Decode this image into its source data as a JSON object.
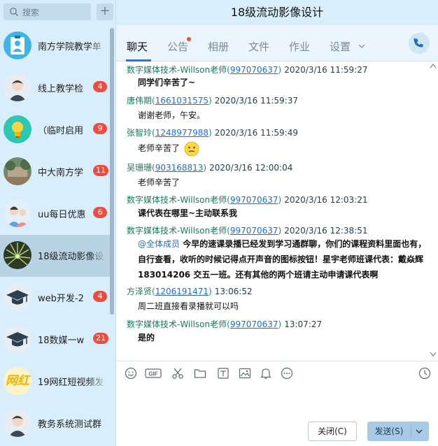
{
  "search": {
    "placeholder": "搜索"
  },
  "window": {
    "title": "18级流动影像设计"
  },
  "conversations": [
    {
      "name": "南方学院教学单",
      "badge": ""
    },
    {
      "name": "线上教学检",
      "badge": "4"
    },
    {
      "name": "（临时启用",
      "badge": "9"
    },
    {
      "name": "中大南方学",
      "badge": "11"
    },
    {
      "name": "uu每日优惠",
      "badge": "6"
    },
    {
      "name": "18级流动影像设",
      "badge": ""
    },
    {
      "name": "web开发-2",
      "badge": "4"
    },
    {
      "name": "18数媒一w",
      "badge": "21"
    },
    {
      "name": "19网红短视频发",
      "badge": ""
    },
    {
      "name": "教务系统测试群",
      "badge": ""
    }
  ],
  "avatar_text": {
    "wanghong": "网红"
  },
  "tabs": [
    "聊天",
    "公告",
    "相册",
    "文件",
    "作业",
    "设置"
  ],
  "messages": [
    {
      "sender": "数字媒体技术-Willson老师",
      "qq": "997070637",
      "time": "2020/3/16 11:59:27",
      "text": "同学们辛苦了~"
    },
    {
      "sender": "唐伟期",
      "qq": "1661031575",
      "time": "2020/3/16 11:59:37",
      "text": "谢谢老师，午安。"
    },
    {
      "sender": "张智玲",
      "qq": "1248977988",
      "time": "2020/3/16 11:59:49",
      "text": "老师辛苦了"
    },
    {
      "sender": "吴珊珊",
      "qq": "903168813",
      "time": "2020/3/16 12:00:04",
      "text": "老师辛苦了"
    },
    {
      "sender": "数字媒体技术-Willson老师",
      "qq": "997070637",
      "time": "2020/3/16 12:03:21",
      "text": "课代表在哪里~主动联系我"
    },
    {
      "sender": "数字媒体技术-Willson老师",
      "qq": "997070637",
      "time": "2020/3/16 12:38:51",
      "mention": "@全体成员",
      "text": "今早的速课录播已经发到学习通群聊，你们的课程资料里面也有，自行查看，收听的时候记得点开声音的图标按钮！星宇老师班课代表：戴焱辉183014206 交五一班。还有其他的两个班请主动申请课代表啊"
    },
    {
      "sender": "方泽贤",
      "qq": "1206191471",
      "time": "13:06:52",
      "text": "周二班直接看录播就可以吗"
    },
    {
      "sender": "数字媒体技术-Willson老师",
      "qq": "997070637",
      "time": "13:07:27",
      "text": "是的"
    }
  ],
  "buttons": {
    "close": "关闭(C)",
    "send": "发送(S)"
  },
  "colors": {
    "sidebar_bg": "#d9eefc",
    "badge": "#f04b3e",
    "accent": "#1e7bd6",
    "send_bg": "#a7cbe6"
  }
}
